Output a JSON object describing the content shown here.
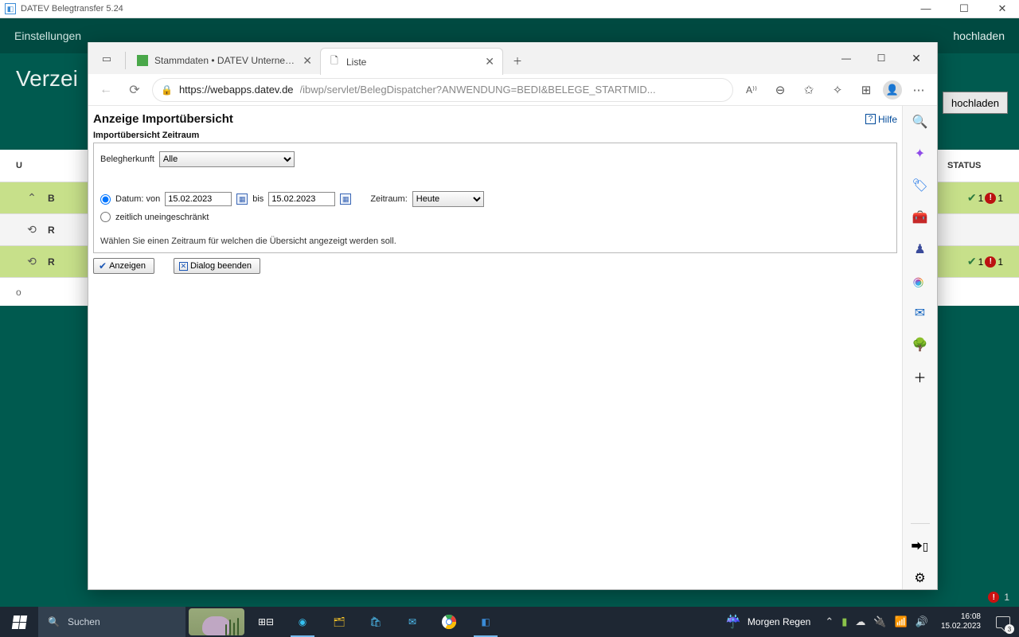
{
  "app": {
    "title": "DATEV Belegtransfer 5.24",
    "menu": {
      "settings": "Einstellungen",
      "upload_all": "hochladen"
    },
    "bg_title": "Verzei",
    "upload_button": "hochladen",
    "table": {
      "col_upload": "U",
      "col_status": "STATUS",
      "rows": [
        {
          "green": true,
          "chev": "⌃",
          "text": "B",
          "status": {
            "ok": 1,
            "err": 1
          }
        },
        {
          "green": false,
          "text": "R"
        },
        {
          "green": true,
          "text": "R",
          "status": {
            "ok": 1,
            "err": 1
          }
        }
      ],
      "footer": "o"
    },
    "notif_count": "1"
  },
  "browser": {
    "tabs": [
      {
        "title": "Stammdaten • DATEV Unternehm",
        "active": false
      },
      {
        "title": "Liste",
        "active": true
      }
    ],
    "url_domain": "https://webapps.datev.de",
    "url_path": "/ibwp/servlet/BelegDispatcher?ANWENDUNG=BEDI&BELEGE_STARTMID...",
    "read_aloud": "A⁾⁾"
  },
  "page": {
    "title": "Anzeige Importübersicht",
    "help": "Hilfe",
    "fieldset_label": "Importübersicht Zeitraum",
    "herkunft_label": "Belegherkunft",
    "herkunft_value": "Alle",
    "radio_date_label": "Datum: von",
    "date_from": "15.02.2023",
    "bis": "bis",
    "date_to": "15.02.2023",
    "zeitraum_label": "Zeitraum:",
    "zeitraum_value": "Heute",
    "radio_unrestricted": "zeitlich uneingeschränkt",
    "hint": "Wählen Sie einen Zeitraum für welchen die Übersicht angezeigt werden soll.",
    "btn_show": "Anzeigen",
    "btn_close": "Dialog beenden"
  },
  "taskbar": {
    "search_placeholder": "Suchen",
    "weather": "Morgen Regen",
    "time": "16:08",
    "date": "15.02.2023",
    "action_badge": "3"
  }
}
